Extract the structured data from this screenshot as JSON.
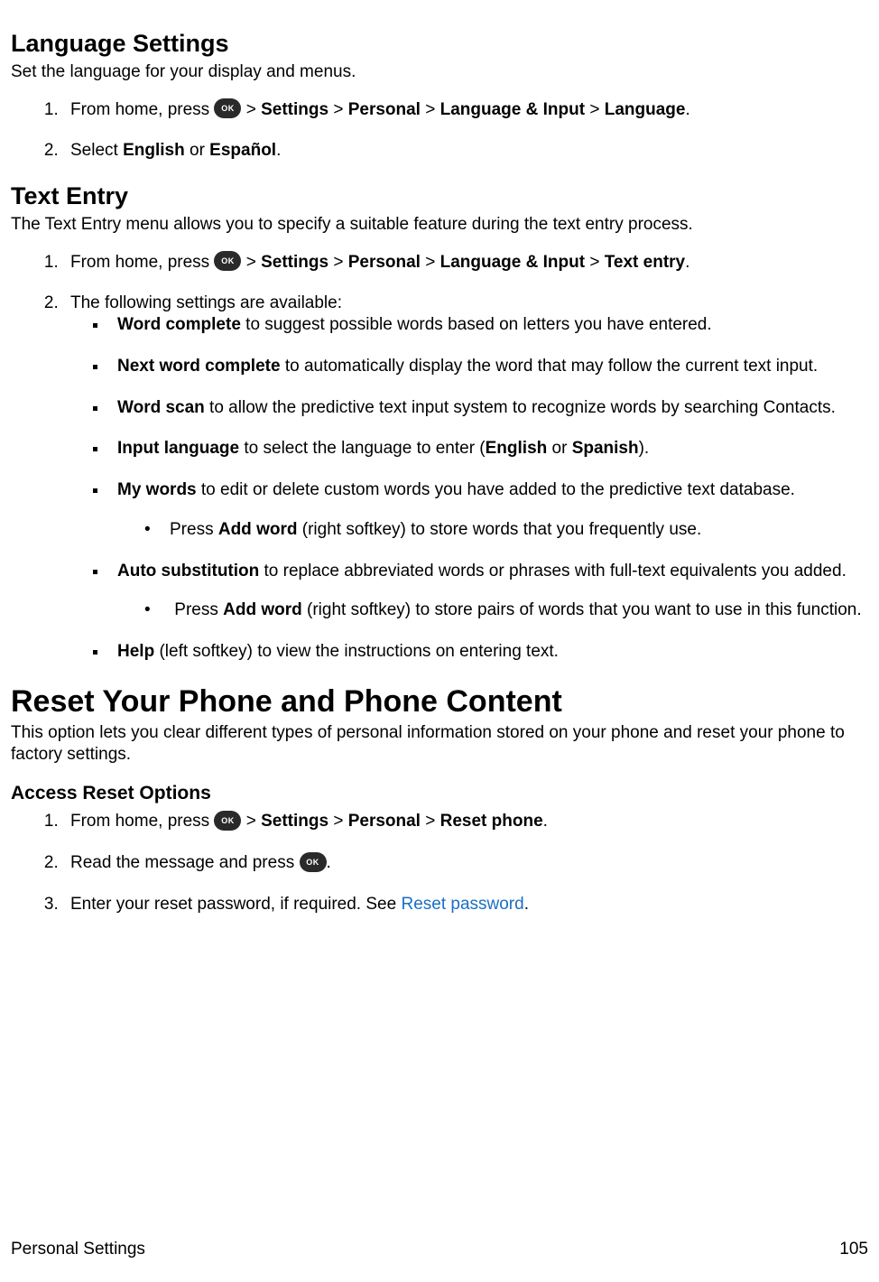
{
  "langSettings": {
    "heading": "Language Settings",
    "intro": "Set the language for your display and menus.",
    "step1_a": "From home, press ",
    "step1_b": " > ",
    "settings": "Settings",
    "personal": "Personal",
    "langInput": "Language & Input",
    "language": "Language",
    "step1_end": ".",
    "step2_a": "Select ",
    "english": "English",
    "or": " or ",
    "espanol": "Español",
    "period": "."
  },
  "textEntry": {
    "heading": "Text Entry",
    "intro": "The Text Entry menu allows you to specify a suitable feature during the text entry process.",
    "step1_a": "From home, press ",
    "gt": " > ",
    "settings": "Settings",
    "personal": "Personal",
    "langInput": "Language & Input",
    "textentry": "Text entry",
    "period": ".",
    "step2": "The following settings are available:",
    "bullets": {
      "wordComplete_b": "Word complete",
      "wordComplete_t": " to suggest possible words based on letters you have entered.",
      "nextWord_b": "Next word complete",
      "nextWord_t": " to automatically display the word that may follow the current text input.",
      "wordScan_b": "Word scan",
      "wordScan_t": " to allow the predictive text input system to recognize words by searching Contacts.",
      "inputLang_b": "Input language",
      "inputLang_t1": " to select the language to enter (",
      "inputLang_en": "English",
      "inputLang_or": " or ",
      "inputLang_sp": "Spanish",
      "inputLang_t2": ").",
      "myWords_b": "My words",
      "myWords_t": " to edit or delete custom words you have added to the predictive text database.",
      "myWords_sub_a": "Press ",
      "myWords_sub_b": "Add word",
      "myWords_sub_c": " (right softkey) to store words that you frequently use.",
      "autoSub_b": "Auto substitution",
      "autoSub_t": " to replace abbreviated words or phrases with full-text equivalents you added.",
      "autoSub_sub_a": " Press ",
      "autoSub_sub_b": "Add word",
      "autoSub_sub_c": " (right softkey)  to store pairs of words that you want to use in this function.",
      "help_b": "Help",
      "help_t": " (left softkey) to view the instructions on entering text."
    }
  },
  "reset": {
    "heading": "Reset Your Phone and Phone Content",
    "intro": "This option lets you clear different types of personal information stored on your phone and reset your phone to factory settings.",
    "subhead": "Access Reset Options",
    "step1_a": "From home, press ",
    "gt": " > ",
    "settings": "Settings",
    "personal": "Personal",
    "resetPhone": "Reset phone",
    "period": ".",
    "step2_a": "Read the message and press ",
    "step2_b": ".",
    "step3_a": "Enter your reset password, if required. See ",
    "step3_link": "Reset password",
    "step3_b": "."
  },
  "footer": {
    "left": "Personal Settings",
    "right": "105"
  },
  "icons": {
    "ok": "OK"
  }
}
